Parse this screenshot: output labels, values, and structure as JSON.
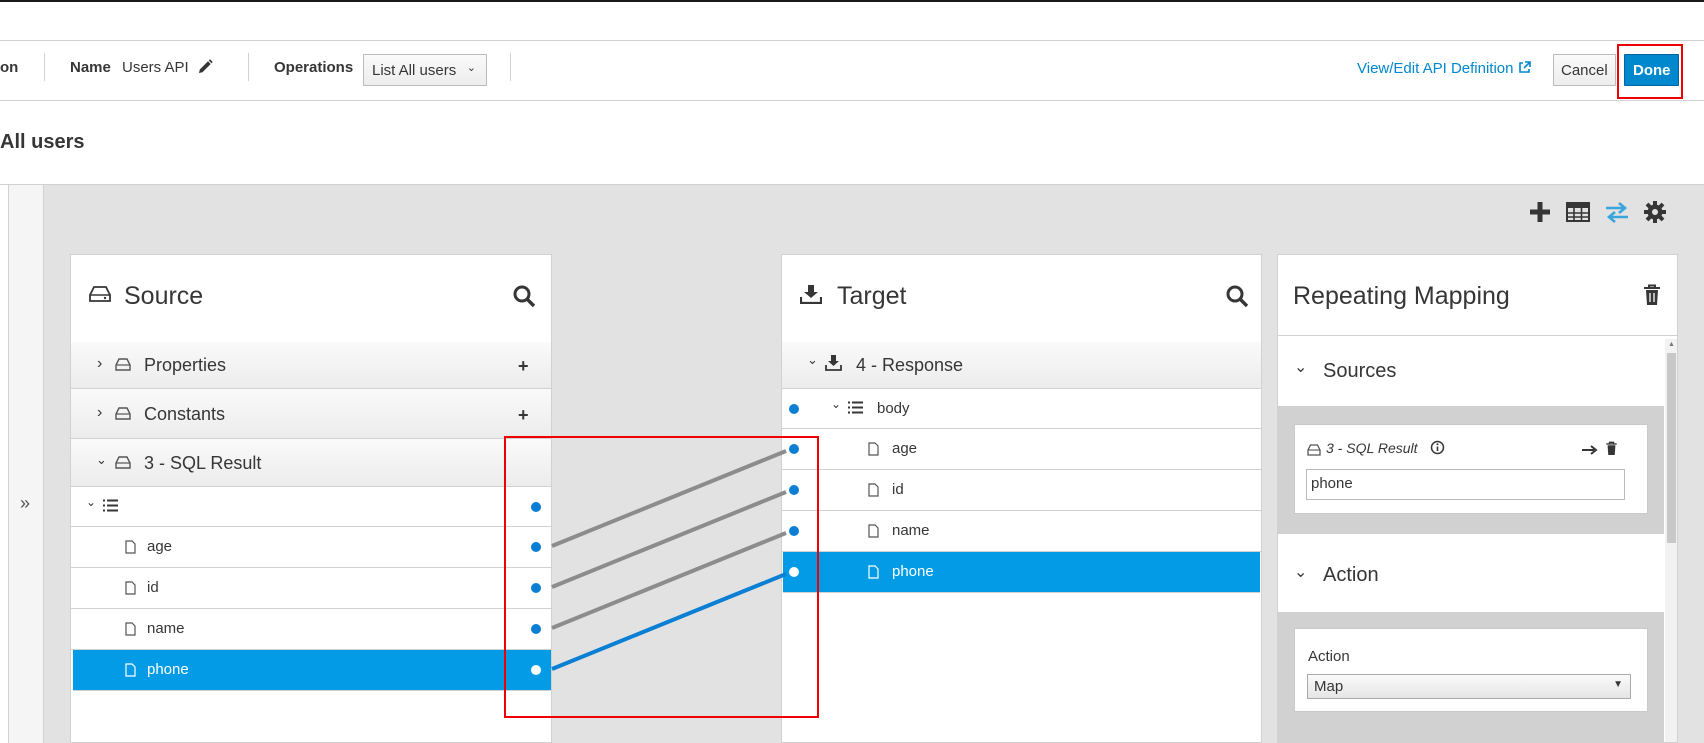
{
  "header": {
    "crumb_fragment": "on",
    "name_label": "Name",
    "name_value": "Users API",
    "operations_label": "Operations",
    "operations_value": "List All users",
    "view_edit_link": "View/Edit API Definition",
    "cancel_label": "Cancel",
    "done_label": "Done"
  },
  "page_title": "All users",
  "expand_glyph": "»",
  "toolbar": {
    "icons": [
      "plus-icon",
      "table-icon",
      "exchange-icon",
      "gear-icon"
    ],
    "accent": "#39a5dc"
  },
  "source": {
    "title": "Source",
    "groups": [
      {
        "label": "Properties",
        "expanded": false
      },
      {
        "label": "Constants",
        "expanded": false
      },
      {
        "label": "3 - SQL Result",
        "expanded": true
      }
    ],
    "fields": [
      "age",
      "id",
      "name",
      "phone"
    ],
    "selected_field": "phone"
  },
  "target": {
    "title": "Target",
    "group": "4 - Response",
    "collection": "body",
    "fields": [
      "age",
      "id",
      "name",
      "phone"
    ],
    "selected_field": "phone"
  },
  "mapping": {
    "title": "Repeating Mapping",
    "sources_label": "Sources",
    "source_doc": "3 - SQL Result",
    "source_field_value": "phone",
    "action_section_label": "Action",
    "action_field_label": "Action",
    "action_value": "Map"
  },
  "colors": {
    "brand_blue": "#0088ce",
    "selected_row": "#039be5",
    "connector_gray": "#8c8c8c",
    "connector_active": "#0a7fd4",
    "highlight_red": "#ee0000"
  }
}
